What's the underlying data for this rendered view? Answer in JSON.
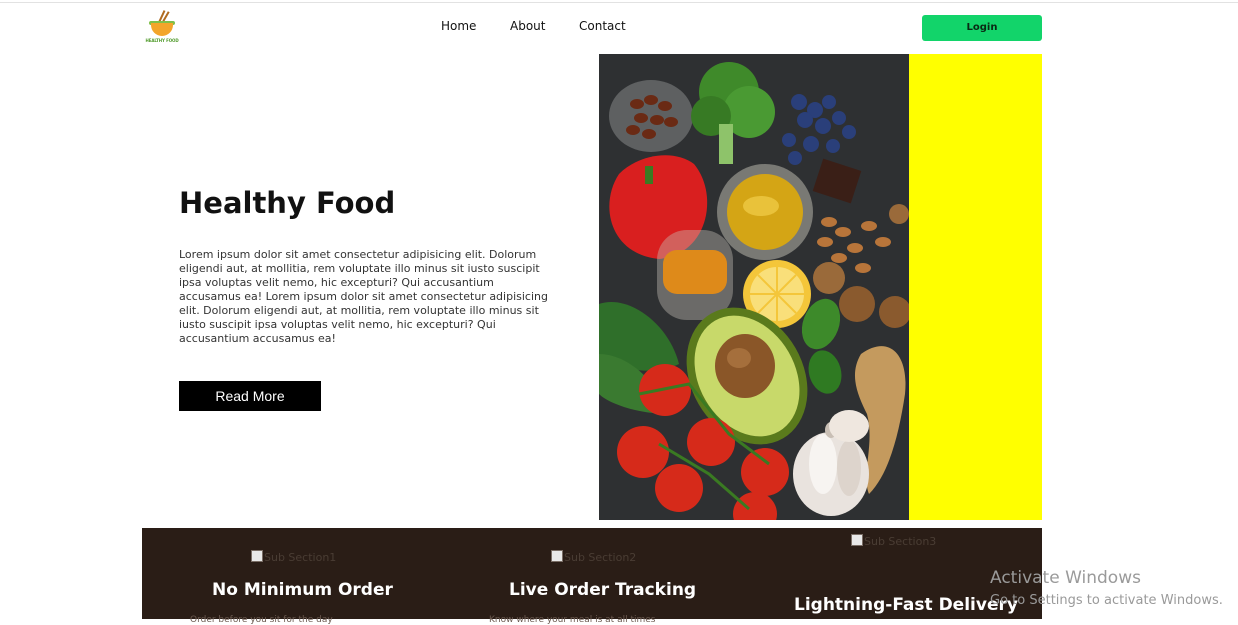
{
  "header": {
    "logo_text": "HEALTHY FOOD",
    "nav": [
      {
        "label": "Home"
      },
      {
        "label": "About"
      },
      {
        "label": "Contact"
      }
    ],
    "login_label": "Login"
  },
  "hero": {
    "title": "Healthy Food",
    "text": "Lorem ipsum dolor sit amet consectetur adipisicing elit. Dolorum eligendi aut, at mollitia, rem voluptate illo minus sit iusto suscipit ipsa voluptas velit nemo, hic excepturi? Qui accusantium accusamus ea! Lorem ipsum dolor sit amet consectetur adipisicing elit. Dolorum eligendi aut, at mollitia, rem voluptate illo minus sit iusto suscipit ipsa voluptas velit nemo, hic excepturi? Qui accusantium accusamus ea!",
    "button_label": "Read More"
  },
  "features": [
    {
      "img_alt": "Sub Section1",
      "title": "No Minimum Order",
      "desc": "Order before you sit for the day"
    },
    {
      "img_alt": "Sub Section2",
      "title": "Live Order Tracking",
      "desc": "Know where your meal is at all times"
    },
    {
      "img_alt": "Sub Section3",
      "title": "Lightning-Fast Delivery",
      "desc": ""
    }
  ],
  "colors": {
    "login_green": "#12d46a",
    "panel_yellow": "#ffff00",
    "features_bg": "#2a1d16"
  },
  "watermark": {
    "title": "Activate Windows",
    "subtitle": "Go to Settings to activate Windows."
  }
}
